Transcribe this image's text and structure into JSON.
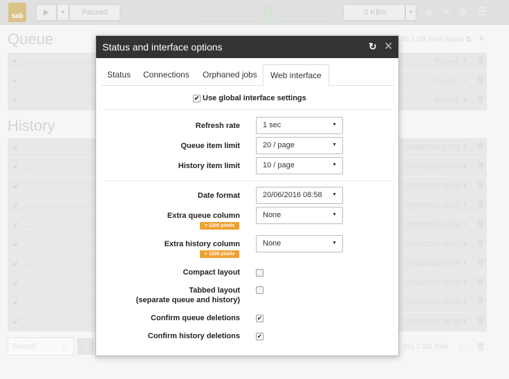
{
  "topbar": {
    "logo_text": "sab",
    "paused_label": "Paused",
    "speed_label": "0 KB/s",
    "icons": [
      "play-icon",
      "chevron-down-icon",
      "link-icon",
      "chevron-down-icon",
      "plus-circle-icon",
      "wrench-icon",
      "gear-icon",
      "menu-icon"
    ]
  },
  "queue": {
    "title": "Queue",
    "free_space": "90.3 GB Free Space",
    "rows": [
      {
        "status": "Paused"
      },
      {
        "status": "Paused"
      },
      {
        "status": "Paused"
      }
    ]
  },
  "history": {
    "title": "History",
    "rows": [
      {
        "time": "20/06/2016 17:14"
      },
      {
        "time": "20/06/2016 17:12"
      },
      {
        "time": "20/06/2016 15:12"
      },
      {
        "time": "20/06/2016 15:10"
      },
      {
        "time": "20/06/2016 15:09"
      },
      {
        "time": "20/06/2016 15:07"
      },
      {
        "time": "20/06/2016 10:58"
      },
      {
        "time": "20/06/2016 10:56"
      },
      {
        "time": "20/06/2016 10:55"
      },
      {
        "time": "20/06/2016 08:35"
      }
    ],
    "search_placeholder": "Search",
    "page": "1",
    "total": "393.2 GB Total"
  },
  "modal": {
    "title": "Status and interface options",
    "tabs": [
      {
        "label": "Status",
        "active": false
      },
      {
        "label": "Connections",
        "active": false
      },
      {
        "label": "Orphaned jobs",
        "active": false
      },
      {
        "label": "Web interface",
        "active": true
      }
    ],
    "global_settings_label": "Use global interface settings",
    "global_settings_checked": true,
    "fields": {
      "refresh_rate": {
        "label": "Refresh rate",
        "value": "1 sec"
      },
      "queue_limit": {
        "label": "Queue item limit",
        "value": "20 / page"
      },
      "history_limit": {
        "label": "History item limit",
        "value": "10 / page"
      },
      "date_format": {
        "label": "Date format",
        "value": "20/06/2016 08:58"
      },
      "extra_queue_column": {
        "label": "Extra queue column",
        "value": "None",
        "badge": "> 1200 pixels"
      },
      "extra_history_column": {
        "label": "Extra history column",
        "value": "None",
        "badge": "> 1200 pixels"
      },
      "compact_layout": {
        "label": "Compact layout",
        "checked": false
      },
      "tabbed_layout": {
        "label_line1": "Tabbed layout",
        "label_line2": "(separate queue and history)",
        "checked": false
      },
      "confirm_queue_deletions": {
        "label": "Confirm queue deletions",
        "checked": true
      },
      "confirm_history_deletions": {
        "label": "Confirm history deletions",
        "checked": true
      }
    }
  },
  "colors": {
    "modal_header_bg": "#333333",
    "badge_bg": "#f0a030",
    "logo_bg": "#c8a24a"
  }
}
